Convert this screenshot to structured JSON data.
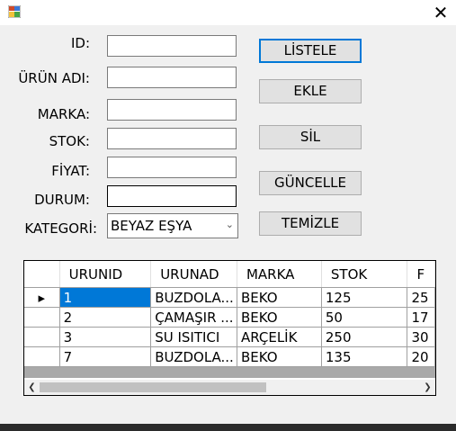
{
  "window": {
    "close_glyph": "✕"
  },
  "form": {
    "labels": {
      "id": "ID:",
      "urun_adi": "ÜRÜN ADI:",
      "marka": "MARKA:",
      "stok": "STOK:",
      "fiyat": "FİYAT:",
      "durum": "DURUM:",
      "kategori": "KATEGORİ:"
    },
    "values": {
      "id": "",
      "urun_adi": "",
      "marka": "",
      "stok": "",
      "fiyat": "",
      "durum": ""
    },
    "kategori_selected": "BEYAZ EŞYA"
  },
  "buttons": {
    "listele": "LİSTELE",
    "ekle": "EKLE",
    "sil": "SİL",
    "guncelle": "GÜNCELLE",
    "temizle": "TEMİZLE"
  },
  "grid": {
    "columns": [
      "URUNID",
      "URUNAD",
      "MARKA",
      "STOK",
      "F"
    ],
    "rows": [
      [
        "1",
        "BUZDOLA...",
        "BEKO",
        "125",
        "25"
      ],
      [
        "2",
        "ÇAMAŞIR ...",
        "BEKO",
        "50",
        "17"
      ],
      [
        "3",
        "SU ISITICI",
        "ARÇELİK",
        "250",
        "30"
      ],
      [
        "7",
        "BUZDOLA...",
        "BEKO",
        "135",
        "20"
      ]
    ],
    "current_row_marker": "▸"
  }
}
